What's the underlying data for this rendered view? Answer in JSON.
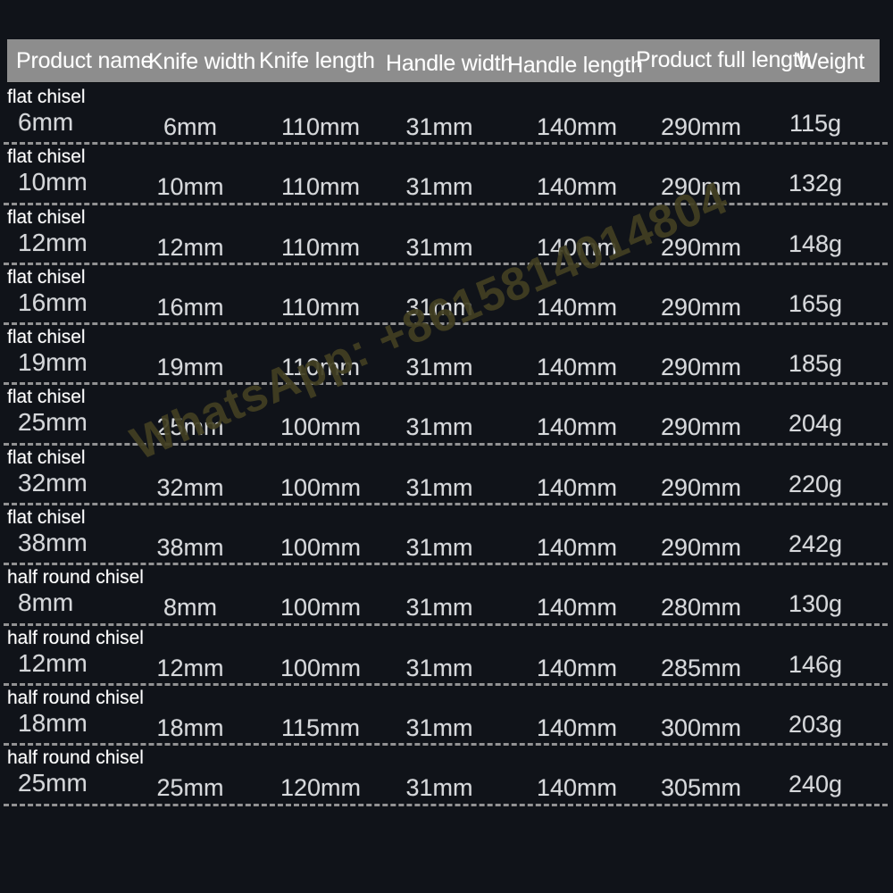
{
  "table": {
    "headers": [
      "Product name",
      "Knife width",
      "Knife length",
      "Handle width",
      "Handle length",
      "Product full length",
      "Weight"
    ],
    "rows": [
      {
        "product_type": "flat chisel",
        "product_size": "6mm",
        "knife_width": "6mm",
        "knife_length": "110mm",
        "handle_width": "31mm",
        "handle_length": "140mm",
        "full_length": "290mm",
        "weight": "115g"
      },
      {
        "product_type": "flat chisel",
        "product_size": "10mm",
        "knife_width": "10mm",
        "knife_length": "110mm",
        "handle_width": "31mm",
        "handle_length": "140mm",
        "full_length": "290mm",
        "weight": "132g"
      },
      {
        "product_type": "flat chisel",
        "product_size": "12mm",
        "knife_width": "12mm",
        "knife_length": "110mm",
        "handle_width": "31mm",
        "handle_length": "140mm",
        "full_length": "290mm",
        "weight": "148g"
      },
      {
        "product_type": "flat chisel",
        "product_size": "16mm",
        "knife_width": "16mm",
        "knife_length": "110mm",
        "handle_width": "31mm",
        "handle_length": "140mm",
        "full_length": "290mm",
        "weight": "165g"
      },
      {
        "product_type": "flat chisel",
        "product_size": "19mm",
        "knife_width": "19mm",
        "knife_length": "110mm",
        "handle_width": "31mm",
        "handle_length": "140mm",
        "full_length": "290mm",
        "weight": "185g"
      },
      {
        "product_type": "flat chisel",
        "product_size": "25mm",
        "knife_width": "25mm",
        "knife_length": "100mm",
        "handle_width": "31mm",
        "handle_length": "140mm",
        "full_length": "290mm",
        "weight": "204g"
      },
      {
        "product_type": "flat chisel",
        "product_size": "32mm",
        "knife_width": "32mm",
        "knife_length": "100mm",
        "handle_width": "31mm",
        "handle_length": "140mm",
        "full_length": "290mm",
        "weight": "220g"
      },
      {
        "product_type": "flat chisel",
        "product_size": "38mm",
        "knife_width": "38mm",
        "knife_length": "100mm",
        "handle_width": "31mm",
        "handle_length": "140mm",
        "full_length": "290mm",
        "weight": "242g"
      },
      {
        "product_type": "half round chisel",
        "product_size": "8mm",
        "knife_width": "8mm",
        "knife_length": "100mm",
        "handle_width": "31mm",
        "handle_length": "140mm",
        "full_length": "280mm",
        "weight": "130g"
      },
      {
        "product_type": "half round chisel",
        "product_size": "12mm",
        "knife_width": "12mm",
        "knife_length": "100mm",
        "handle_width": "31mm",
        "handle_length": "140mm",
        "full_length": "285mm",
        "weight": "146g"
      },
      {
        "product_type": "half round chisel",
        "product_size": "18mm",
        "knife_width": "18mm",
        "knife_length": "115mm",
        "handle_width": "31mm",
        "handle_length": "140mm",
        "full_length": "300mm",
        "weight": "203g"
      },
      {
        "product_type": "half round chisel",
        "product_size": "25mm",
        "knife_width": "25mm",
        "knife_length": "120mm",
        "handle_width": "31mm",
        "handle_length": "140mm",
        "full_length": "305mm",
        "weight": "240g"
      }
    ]
  },
  "watermark": {
    "text": "WhatsApp: +8615814014804"
  },
  "colors": {
    "background": "#101319",
    "header_band": "#8d8d8d",
    "header_text": "#ffffff",
    "cell_text": "#d7d9dc",
    "product_type_text": "#ffffff",
    "separator": "#a9a9a9",
    "watermark": "#423f22"
  }
}
